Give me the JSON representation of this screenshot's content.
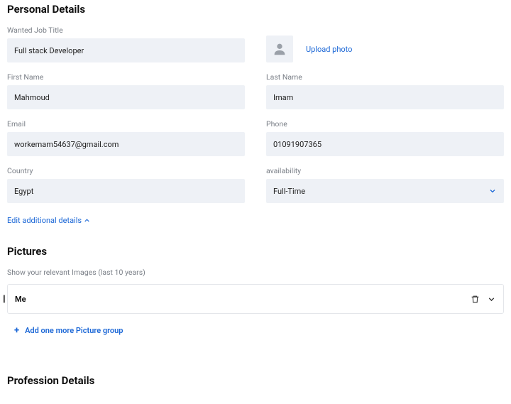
{
  "sections": {
    "personal": {
      "title": "Personal Details"
    },
    "pictures": {
      "title": "Pictures",
      "help": "Show your relevant Images (last 10 years)"
    },
    "profession": {
      "title": "Profession Details"
    }
  },
  "fields": {
    "wantedJobTitle": {
      "label": "Wanted Job Title",
      "value": "Full stack Developer"
    },
    "uploadPhoto": {
      "label": "Upload photo"
    },
    "firstName": {
      "label": "First Name",
      "value": "Mahmoud"
    },
    "lastName": {
      "label": "Last Name",
      "value": "Imam"
    },
    "email": {
      "label": "Email",
      "value": "workemam54637@gmail.com"
    },
    "phone": {
      "label": "Phone",
      "value": "01091907365"
    },
    "country": {
      "label": "Country",
      "value": "Egypt"
    },
    "availability": {
      "label": "availability",
      "value": "Full-Time"
    }
  },
  "links": {
    "editDetails": "Edit additional details",
    "addPictureGroup": "Add one more Picture group"
  },
  "pictureGroups": [
    {
      "title": "Me"
    }
  ]
}
